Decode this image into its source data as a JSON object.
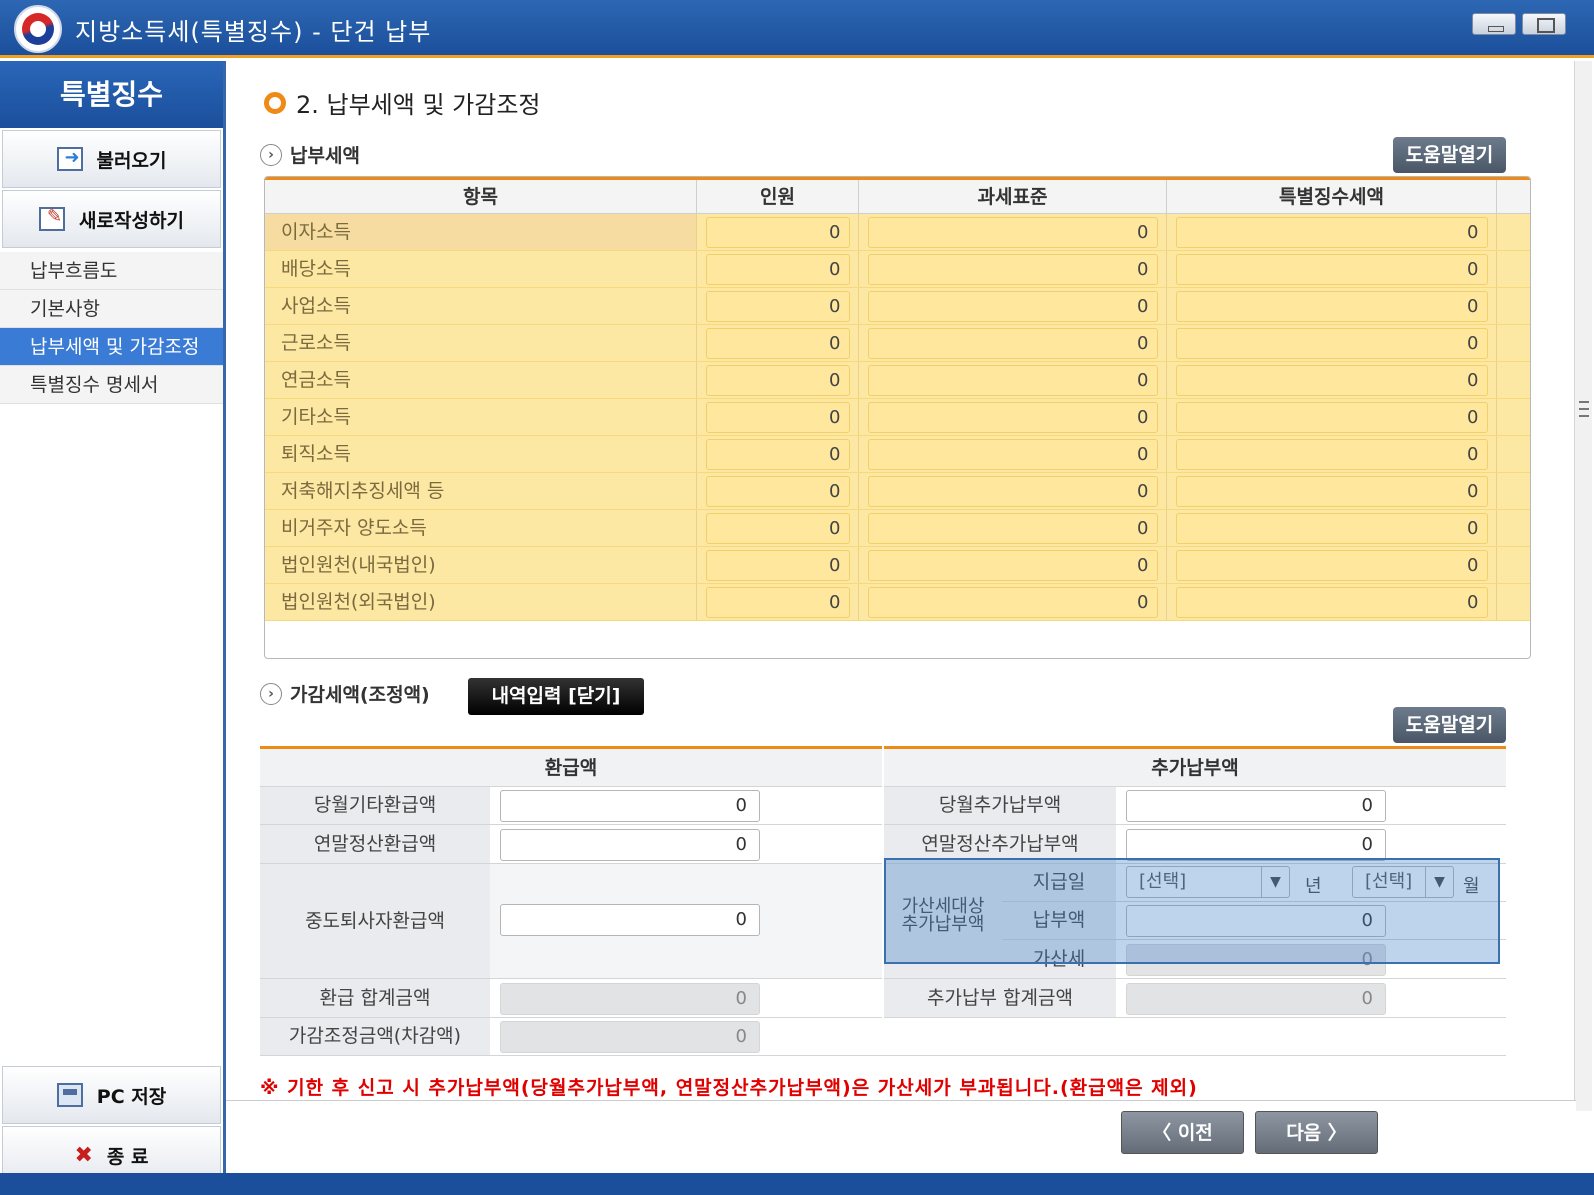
{
  "window": {
    "title": "지방소득세(특별징수) - 단건 납부"
  },
  "sidebar": {
    "header": "특별징수",
    "load_label": "불러오기",
    "new_label": "새로작성하기",
    "menu": [
      {
        "label": "납부흐름도"
      },
      {
        "label": "기본사항"
      },
      {
        "label": "납부세액 및 가감조정"
      },
      {
        "label": "특별징수 명세서"
      }
    ],
    "save_label": "PC 저장",
    "exit_label": "종 료"
  },
  "main": {
    "page_title": "2. 납부세액 및 가감조정",
    "section1_title": "납부세액",
    "help_label": "도움말열기",
    "table1": {
      "headers": [
        "항목",
        "인원",
        "과세표준",
        "특별징수세액"
      ],
      "rows": [
        {
          "label": "이자소득",
          "count": "0",
          "base": "0",
          "tax": "0"
        },
        {
          "label": "배당소득",
          "count": "0",
          "base": "0",
          "tax": "0"
        },
        {
          "label": "사업소득",
          "count": "0",
          "base": "0",
          "tax": "0"
        },
        {
          "label": "근로소득",
          "count": "0",
          "base": "0",
          "tax": "0"
        },
        {
          "label": "연금소득",
          "count": "0",
          "base": "0",
          "tax": "0"
        },
        {
          "label": "기타소득",
          "count": "0",
          "base": "0",
          "tax": "0"
        },
        {
          "label": "퇴직소득",
          "count": "0",
          "base": "0",
          "tax": "0"
        },
        {
          "label": "저축해지추징세액 등",
          "count": "0",
          "base": "0",
          "tax": "0"
        },
        {
          "label": "비거주자 양도소득",
          "count": "0",
          "base": "0",
          "tax": "0"
        },
        {
          "label": "법인원천(내국법인)",
          "count": "0",
          "base": "0",
          "tax": "0"
        },
        {
          "label": "법인원천(외국법인)",
          "count": "0",
          "base": "0",
          "tax": "0"
        }
      ]
    },
    "section2_title": "가감세액(조정액)",
    "detail_button": "내역입력 [닫기]",
    "table2": {
      "refund_header": "환급액",
      "additional_header": "추가납부액",
      "refund": {
        "monthly_other_label": "당월기타환급액",
        "monthly_other_value": "0",
        "yearend_label": "연말정산환급액",
        "yearend_value": "0",
        "midterm_label": "중도퇴사자환급액",
        "midterm_value": "0",
        "total_label": "환급 합계금액",
        "total_value": "0",
        "adjust_label": "가감조정금액(차감액)",
        "adjust_value": "0"
      },
      "additional": {
        "monthly_label": "당월추가납부액",
        "monthly_value": "0",
        "yearend_label": "연말정산추가납부액",
        "yearend_value": "0",
        "penalty_group_label_1": "가산세대상",
        "penalty_group_label_2": "추가납부액",
        "pay_date_label": "지급일",
        "year_select": "[선택]",
        "year_unit": "년",
        "month_select": "[선택]",
        "month_unit": "월",
        "pay_amount_label": "납부액",
        "pay_amount_value": "0",
        "penalty_label": "가산세",
        "penalty_value": "0",
        "total_label": "추가납부 합계금액",
        "total_value": "0"
      }
    },
    "note": "※ 기한 후 신고 시 추가납부액(당월추가납부액, 연말정산추가납부액)은 가산세가 부과됩니다.(환급액은 제외)"
  },
  "nav": {
    "prev_label": "〈 이전",
    "next_label": "다음 〉"
  },
  "colors": {
    "accent": "#f08a16",
    "brand": "#1b4f9b",
    "row_fill": "#fce7a3",
    "note": "#e00000"
  }
}
